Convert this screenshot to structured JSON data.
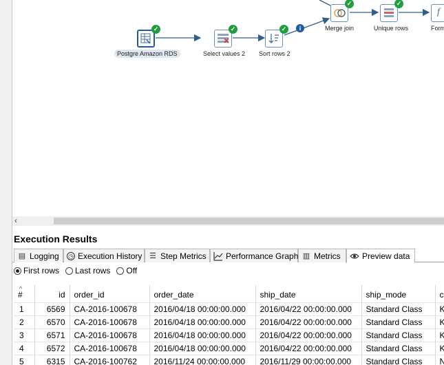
{
  "canvas": {
    "steps": [
      {
        "label": "Postgre Amazon RDS",
        "icon": "table-input-icon"
      },
      {
        "label": "Select values 2",
        "icon": "select-values-icon"
      },
      {
        "label": "Sort rows 2",
        "icon": "sort-rows-icon"
      },
      {
        "label": "Merge join",
        "icon": "merge-join-icon"
      },
      {
        "label": "Unique rows",
        "icon": "unique-rows-icon"
      },
      {
        "label": "Form",
        "icon": "formula-icon"
      }
    ]
  },
  "results": {
    "title": "Execution Results",
    "tabs": [
      {
        "label": "Logging",
        "icon": "logging-icon"
      },
      {
        "label": "Execution History",
        "icon": "history-icon"
      },
      {
        "label": "Step Metrics",
        "icon": "step-metrics-icon"
      },
      {
        "label": "Performance Graph",
        "icon": "performance-graph-icon"
      },
      {
        "label": "Metrics",
        "icon": "metrics-icon"
      },
      {
        "label": "Preview data",
        "icon": "eye-icon"
      }
    ],
    "active_tab": "Preview data",
    "radio_options": [
      "First rows",
      "Last rows",
      "Off"
    ],
    "selected_option": "First rows",
    "table": {
      "columns": [
        "#",
        "id",
        "order_id",
        "order_date",
        "ship_date",
        "ship_mode",
        "c"
      ],
      "rows": [
        [
          "1",
          "6569",
          "CA-2016-100678",
          "2016/04/18 00:00:00.000",
          "2016/04/22 00:00:00.000",
          "Standard Class",
          "K"
        ],
        [
          "2",
          "6570",
          "CA-2016-100678",
          "2016/04/18 00:00:00.000",
          "2016/04/22 00:00:00.000",
          "Standard Class",
          "K"
        ],
        [
          "3",
          "6571",
          "CA-2016-100678",
          "2016/04/18 00:00:00.000",
          "2016/04/22 00:00:00.000",
          "Standard Class",
          "K"
        ],
        [
          "4",
          "6572",
          "CA-2016-100678",
          "2016/04/18 00:00:00.000",
          "2016/04/22 00:00:00.000",
          "Standard Class",
          "K"
        ],
        [
          "5",
          "6315",
          "CA-2016-100762",
          "2016/11/24 00:00:00.000",
          "2016/11/29 00:00:00.000",
          "Standard Class",
          "N"
        ]
      ]
    }
  },
  "colors": {
    "accent": "#1f5aa8",
    "ok_badge": "#1e9e3c",
    "info_badge": "#1f5aa8",
    "hop": "#2f5f8a"
  }
}
